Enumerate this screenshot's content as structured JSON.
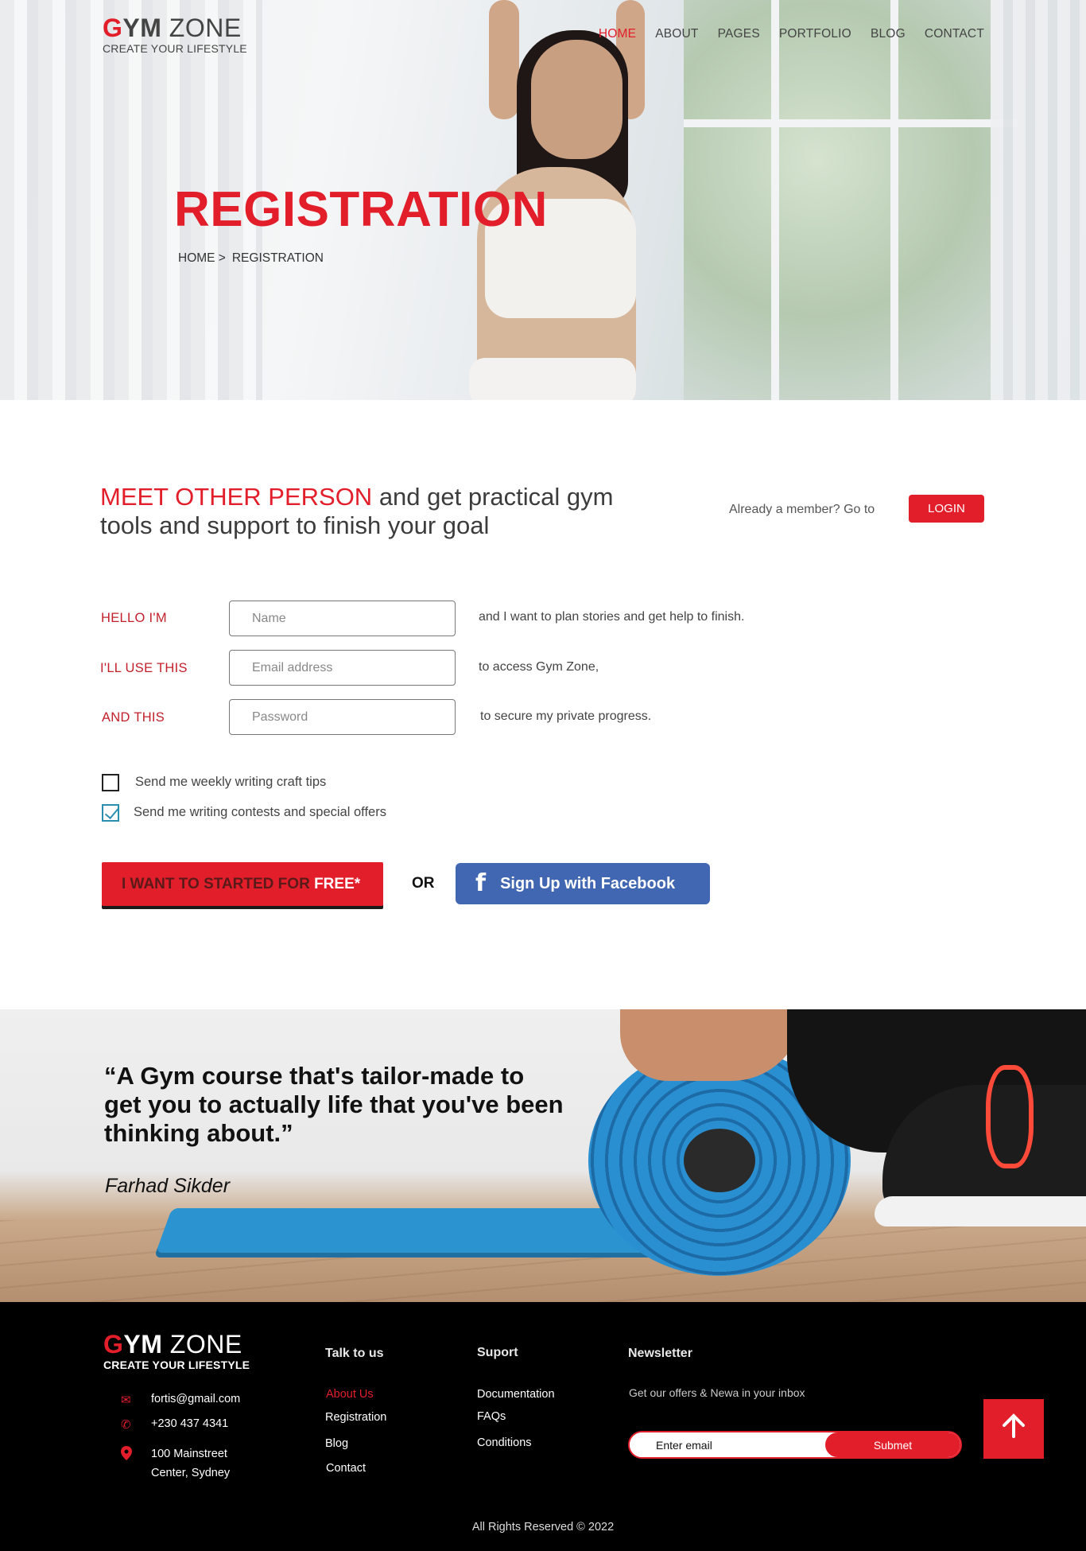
{
  "brand": {
    "g": "G",
    "ym": "YM",
    "zone": " ZONE",
    "tagline": "CREATE YOUR LIFESTYLE"
  },
  "nav": [
    "HOME",
    "ABOUT",
    "PAGES",
    "PORTFOLIO",
    "BLOG",
    "CONTACT"
  ],
  "hero": {
    "title": "REGISTRATION",
    "breadcrumb": {
      "home": "HOME >",
      "current": "REGISTRATION"
    }
  },
  "intro": {
    "highlight": "MEET OTHER PERSON",
    "text": " and get practical gym tools and support to finish your goal",
    "member_text": "Already a member? Go to",
    "login_label": "LOGIN"
  },
  "form": {
    "rows": [
      {
        "label": "HELLO I'M",
        "placeholder": "Name",
        "desc": "and I want to plan stories and get help to finish."
      },
      {
        "label": "I'LL USE THIS",
        "placeholder": "Email address",
        "desc": "to access Gym Zone,"
      },
      {
        "label": "AND THIS",
        "placeholder": "Password",
        "desc": "to secure my private progress."
      }
    ],
    "checkboxes": [
      {
        "label": "Send me weekly writing craft tips",
        "checked": false
      },
      {
        "label": "Send me writing contests and special offers",
        "checked": true
      }
    ],
    "cta_main": "I WANT TO  STARTED FOR ",
    "cta_free": "FREE*",
    "or": "OR",
    "facebook_icon": "f",
    "facebook_label": "Sign Up with Facebook"
  },
  "quote": {
    "text": "“A Gym course that's tailor-made to get you to actually life that you've been thinking about.”",
    "author": "Farhad Sikder"
  },
  "footer": {
    "contact": [
      {
        "icon": "mail-icon",
        "glyph": "✉",
        "text": "fortis@gmail.com"
      },
      {
        "icon": "phone-icon",
        "glyph": "✆",
        "text": "+230 437 4341"
      },
      {
        "icon": "location-icon",
        "glyph": "⬤",
        "text": "100 Mainstreet",
        "text2": "Center, Sydney"
      }
    ],
    "talk": {
      "title": "Talk to us",
      "links": [
        "About Us",
        "Registration",
        "Blog",
        "Contact"
      ]
    },
    "support": {
      "title": "Suport",
      "links": [
        "Documentation",
        "FAQs",
        "Conditions"
      ]
    },
    "newsletter": {
      "title": "Newsletter",
      "text": "Get our offers & Newa in your inbox",
      "placeholder": "Enter email",
      "submit": "Submet"
    },
    "scroll_top_icon": "arrow-up-icon",
    "copyright": "All Rights Reserved © 2022"
  },
  "colors": {
    "accent": "#e31e2b",
    "facebook": "#4267b2",
    "footer_bg": "#000000"
  }
}
